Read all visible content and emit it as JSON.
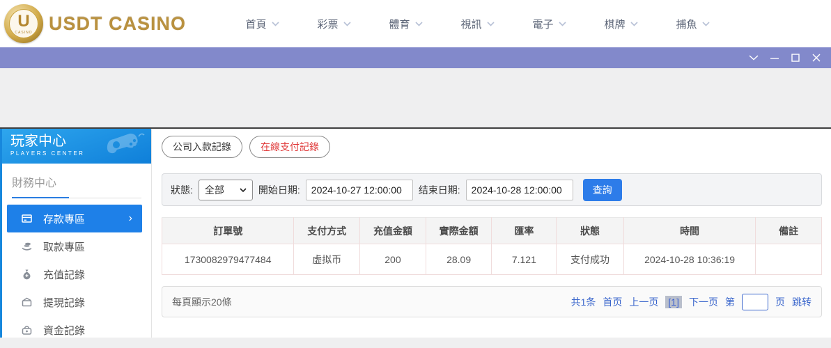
{
  "brand": {
    "name": "USDT CASINO",
    "logo_letter": "U",
    "logo_caption": "CASINO"
  },
  "top_nav": {
    "items": [
      "首頁",
      "彩票",
      "體育",
      "視訊",
      "電子",
      "棋牌",
      "捕魚"
    ]
  },
  "sidebar": {
    "title": "玩家中心",
    "subtitle": "PLAYERS CENTER",
    "section_title": "財務中心",
    "items": [
      {
        "label": "存款專區",
        "active": true
      },
      {
        "label": "取款專區",
        "active": false
      },
      {
        "label": "充值記錄",
        "active": false
      },
      {
        "label": "提現記錄",
        "active": false
      },
      {
        "label": "資金記錄",
        "active": false
      }
    ],
    "active_arrow": "›"
  },
  "main": {
    "tabs": [
      {
        "label": "公司入款記錄",
        "active": false
      },
      {
        "label": "在線支付記錄",
        "active": true
      }
    ],
    "filters": {
      "status_label": "狀態:",
      "status_value": "全部",
      "start_label": "開始日期:",
      "start_value": "2024-10-27 12:00:00",
      "end_label": "结束日期:",
      "end_value": "2024-10-28 12:00:00",
      "search_label": "查詢"
    },
    "table": {
      "headers": [
        "訂單號",
        "支付方式",
        "充值金額",
        "實際金額",
        "匯率",
        "狀態",
        "時間",
        "備註"
      ],
      "rows": [
        [
          "1730082979477484",
          "虚拟币",
          "200",
          "28.09",
          "7.121",
          "支付成功",
          "2024-10-28 10:36:19",
          ""
        ]
      ]
    },
    "pagination": {
      "page_size_text": "每頁顯示20條",
      "total_text": "共1条",
      "first_label": "首页",
      "prev_label": "上一页",
      "current_page": "[1]",
      "next_label": "下一页",
      "jump_prefix": "第",
      "jump_suffix": "页",
      "jump_label": "跳转"
    }
  },
  "colors": {
    "accent_blue": "#1e80e8",
    "titlebar_purple": "#8289cb",
    "active_tab_red": "#e03a3a",
    "link_blue": "#3a66cc",
    "brand_gold": "#b9913f"
  }
}
